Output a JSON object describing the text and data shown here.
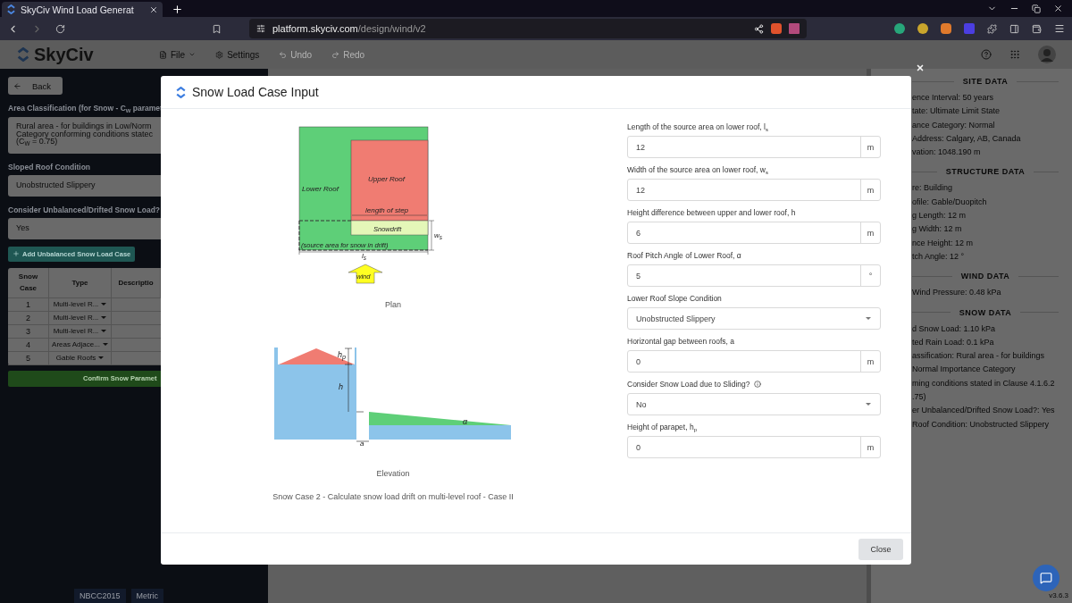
{
  "browser": {
    "tab_title": "SkyCiv Wind Load Generat",
    "url_host": "platform.skyciv.com",
    "url_path": "/design/wind/v2"
  },
  "app_header": {
    "logo": "SkyCiv",
    "menu": [
      {
        "label": "File",
        "kind": "dropdown",
        "disabled": false
      },
      {
        "label": "Settings",
        "kind": "settings",
        "disabled": false
      },
      {
        "label": "Undo",
        "kind": "undo",
        "disabled": true
      },
      {
        "label": "Redo",
        "kind": "redo",
        "disabled": true
      }
    ]
  },
  "left_panel": {
    "back": "Back",
    "area_classification": {
      "label": "Area Classification (for Snow - C$_{W}$ paramet",
      "lines": [
        "Rural area - for buildings in Low/Norm",
        "Category conforming conditions statec",
        "(C$_{W}$ = 0.75)"
      ]
    },
    "sloped_roof": {
      "label": "Sloped Roof Condition",
      "value": "Unobstructed Slippery"
    },
    "unbalanced": {
      "label": "Consider Unbalanced/Drifted Snow Load?",
      "value": "Yes"
    },
    "add_button": "Add Unbalanced Snow Load Case",
    "table": {
      "columns": [
        "Snow Case",
        "Type",
        "Descriptio"
      ],
      "rows": [
        {
          "case": "1",
          "type": "Multi-level R..."
        },
        {
          "case": "2",
          "type": "Multi-level R..."
        },
        {
          "case": "3",
          "type": "Multi-level R..."
        },
        {
          "case": "4",
          "type": "Areas Adjace..."
        },
        {
          "case": "5",
          "type": "Gable Roofs"
        }
      ]
    },
    "confirm_button": "Confirm Snow Paramet",
    "footer": [
      "NBCC2015",
      "Metric"
    ]
  },
  "right_panel": {
    "sections": [
      {
        "heading": "SITE DATA",
        "lines": [
          "ence Interval: 50 years",
          "tate: Ultimate Limit State",
          "ance Category: Normal",
          "Address: Calgary, AB, Canada",
          "vation: 1048.190 m"
        ]
      },
      {
        "heading": "STRUCTURE DATA",
        "lines": [
          "re: Building",
          "ofile: Gable/Duopitch",
          "g Length: 12 m",
          "g Width: 12 m",
          "nce Height: 12 m",
          "tch Angle: 12 °"
        ]
      },
      {
        "heading": "WIND DATA",
        "lines": [
          "Wind Pressure: 0.48 kPa"
        ]
      },
      {
        "heading": "SNOW DATA",
        "lines": [
          "d Snow Load: 1.10 kPa",
          "ted Rain Load: 0.1 kPa",
          "assification: Rural area - for buildings",
          "Normal Importance Category",
          "ming conditions stated in Clause 4.1.6.2",
          ".75)",
          "er Unbalanced/Drifted Snow Load?: Yes",
          "Roof Condition: Unobstructed Slippery"
        ]
      }
    ],
    "version": "v3.6.3"
  },
  "modal": {
    "title": "Snow Load Case Input",
    "plan_labels": [
      {
        "text": "Lower Roof"
      },
      {
        "text": "Upper Roof"
      },
      {
        "text": "length of step"
      },
      {
        "text": "Snowdrift"
      },
      {
        "text": "(source area for snow in drift)"
      },
      {
        "text": "l",
        "sub": "s"
      },
      {
        "text": "w",
        "sub": "s"
      },
      {
        "text": "wind"
      }
    ],
    "plan_caption": "Plan",
    "elevation_labels": [
      {
        "text": "h",
        "sub": "p"
      },
      {
        "text": "h"
      },
      {
        "text": "α"
      },
      {
        "text": "a"
      }
    ],
    "elevation_caption": "Elevation",
    "case_caption": "Snow Case 2 - Calculate snow load drift on multi-level roof - Case II",
    "fields": [
      {
        "kind": "unit",
        "label": "Length of the source area on lower roof, l$_{s}$",
        "value": "12",
        "unit": "m"
      },
      {
        "kind": "unit",
        "label": "Width of the source area on lower roof, w$_{s}$",
        "value": "12",
        "unit": "m"
      },
      {
        "kind": "unit",
        "label": "Height difference between upper and lower roof, h",
        "value": "6",
        "unit": "m"
      },
      {
        "kind": "unit",
        "label": "Roof Pitch Angle of Lower Roof, α",
        "value": "5",
        "unit": "°"
      },
      {
        "kind": "select",
        "label": "Lower Roof Slope Condition",
        "value": "Unobstructed Slippery"
      },
      {
        "kind": "unit",
        "label": "Horizontal gap between roofs, a",
        "value": "0",
        "unit": "m"
      },
      {
        "kind": "select",
        "label": "Consider Snow Load due to Sliding?",
        "info": true,
        "value": "No"
      },
      {
        "kind": "unit",
        "label": "Height of parapet, h$_{p}$",
        "value": "0",
        "unit": "m"
      }
    ],
    "close_button": "Close"
  }
}
